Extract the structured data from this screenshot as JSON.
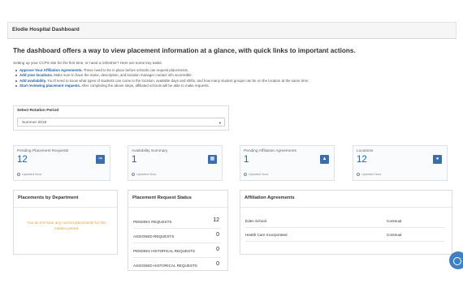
{
  "header": {
    "title": "Elodie Hospital Dashboard"
  },
  "headline": "The dashboard offers a way to view placement information at a glance, with quick links to important actions.",
  "intro": "Setting up your CCPS site for the first time, or need a refresher? Here are some key tasks:",
  "tasks": [
    {
      "bold": "Approve Your Affiliation Agreements.",
      "text": " These need to be in place before schools can request placements."
    },
    {
      "bold": "Add your locations.",
      "text": " Make sure to have the name, description, and location manager contact info accessible."
    },
    {
      "bold": "Add availability.",
      "text": " You’ll need to know what types of students can come to the location, available days and shifts, and how many student groups can be on the location at the same time."
    },
    {
      "bold": "Start reviewing placement requests.",
      "text": " After completing the above steps, affiliated schools will be able to make requests."
    }
  ],
  "rotation": {
    "label": "Select Rotation Period",
    "value": "Summer 2018",
    "caret": "▾"
  },
  "stats": [
    {
      "name": "Pending Placement Requests",
      "value": "12",
      "icon": "⇒",
      "icon_name": "arrow-box-icon",
      "updated": "Updated Now"
    },
    {
      "name": "Availability Summary",
      "value": "1",
      "icon": "▦",
      "icon_name": "calendar-icon",
      "updated": "Updated Now"
    },
    {
      "name": "Pending Affiliation Agreements",
      "value": "1",
      "icon": "▲",
      "icon_name": "warning-icon",
      "updated": "Updated Now"
    },
    {
      "name": "Locations",
      "value": "12",
      "icon": "●",
      "icon_name": "map-pin-icon",
      "updated": "Updated Now"
    }
  ],
  "panels": {
    "departments": {
      "title": "Placements by Department",
      "empty": "You do not have any current placements for this rotation period."
    },
    "status": {
      "title": "Placement Request Status",
      "rows": [
        {
          "label": "PENDING REQUESTS",
          "value": "12"
        },
        {
          "label": "ASSIGNED REQUESTS",
          "value": "0"
        },
        {
          "label": "PENDING HISTORICAL REQUESTS",
          "value": "0"
        },
        {
          "label": "ASSIGNED HISTORICAL REQUESTS",
          "value": "0"
        }
      ]
    },
    "affiliation": {
      "title": "Affiliation Agreements",
      "rows": [
        {
          "name": "Eden School",
          "type": "Contnual"
        },
        {
          "name": "Health Care Incorporated",
          "type": "Contnual"
        }
      ]
    }
  },
  "colors": {
    "accent": "#1f5fa8",
    "icon_bg": "#3d6eaa",
    "warning_text": "#e0a33a",
    "fab": "#3f7fc4"
  }
}
